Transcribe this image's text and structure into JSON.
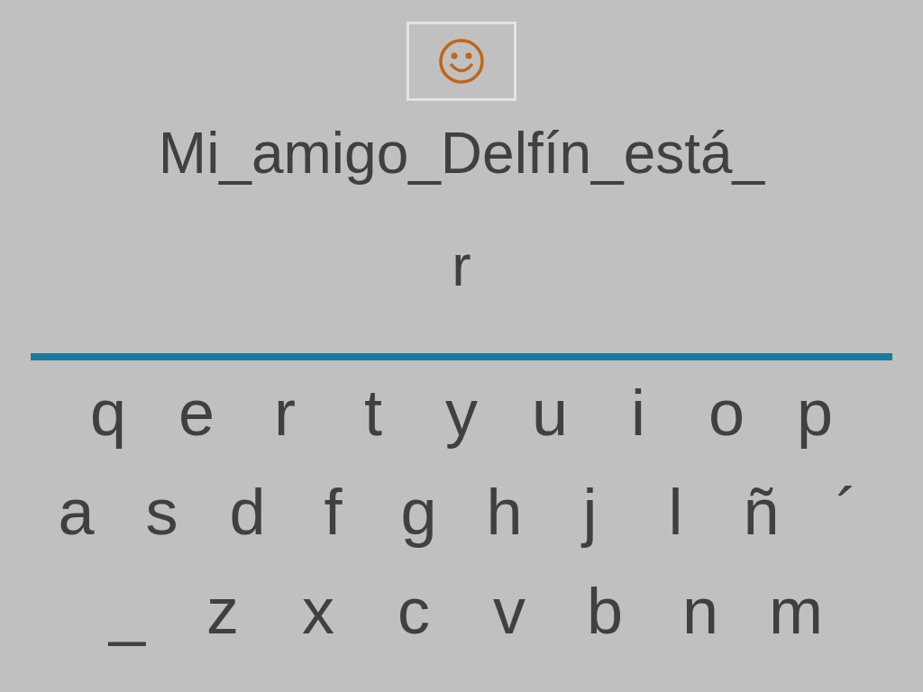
{
  "prompt": "Mi_amigo_Delfín_está_",
  "answer": "r",
  "keyboard": [
    [
      "q",
      "e",
      "r",
      "t",
      "y",
      "u",
      "i",
      "o",
      "p"
    ],
    [
      "a",
      "s",
      "d",
      "f",
      "g",
      "h",
      "j",
      "l",
      "ñ",
      "´"
    ],
    [
      "_",
      "z",
      "x",
      "c",
      "v",
      "b",
      "n",
      "m"
    ]
  ]
}
